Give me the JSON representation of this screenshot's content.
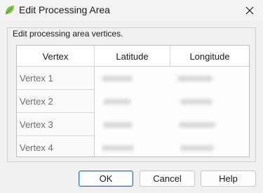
{
  "window": {
    "title": "Edit Processing Area",
    "app_icon": "leaf-icon",
    "close_icon": "close-icon"
  },
  "group": {
    "label": "Edit processing area vertices."
  },
  "table": {
    "headers": [
      "Vertex",
      "Latitude",
      "Longitude"
    ],
    "rows": [
      {
        "vertex": "Vertex 1"
      },
      {
        "vertex": "Vertex 2"
      },
      {
        "vertex": "Vertex 3"
      },
      {
        "vertex": "Vertex 4"
      }
    ]
  },
  "buttons": {
    "ok": "OK",
    "cancel": "Cancel",
    "help": "Help"
  },
  "colors": {
    "accent": "#2a72c6",
    "icon_green": "#7cc243"
  }
}
